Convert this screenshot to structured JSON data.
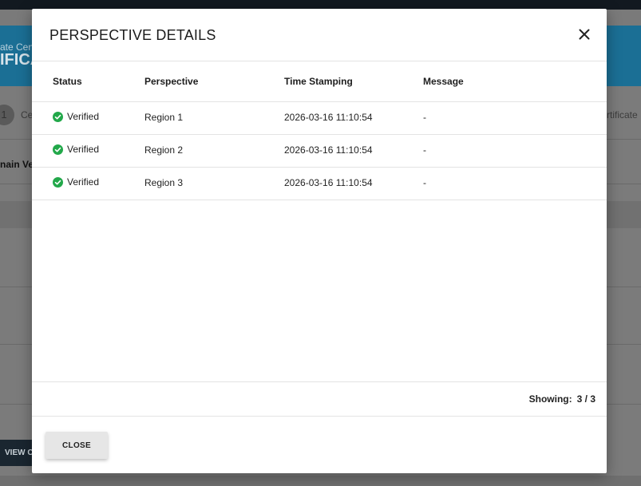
{
  "background": {
    "banner_subtitle": "ate Cent",
    "banner_title": "IFICA",
    "step_number": "1",
    "step_label": "Ce",
    "step_right_label": "rtificate",
    "section_title": "nain Ve",
    "view_button": "VIEW C"
  },
  "modal": {
    "title": "PERSPECTIVE DETAILS",
    "columns": {
      "status": "Status",
      "perspective": "Perspective",
      "time": "Time Stamping",
      "message": "Message"
    },
    "rows": [
      {
        "status": "Verified",
        "perspective": "Region 1",
        "time": "2026-03-16 11:10:54",
        "message": "-"
      },
      {
        "status": "Verified",
        "perspective": "Region 2",
        "time": "2026-03-16 11:10:54",
        "message": "-"
      },
      {
        "status": "Verified",
        "perspective": "Region 3",
        "time": "2026-03-16 11:10:54",
        "message": "-"
      }
    ],
    "showing_label": "Showing:",
    "showing_value": "3 / 3",
    "close_button": "CLOSE"
  },
  "colors": {
    "verified": "#22a84a",
    "banner": "#1b6f95"
  },
  "icons": {
    "status": "check-circle-icon",
    "close": "close-icon"
  }
}
